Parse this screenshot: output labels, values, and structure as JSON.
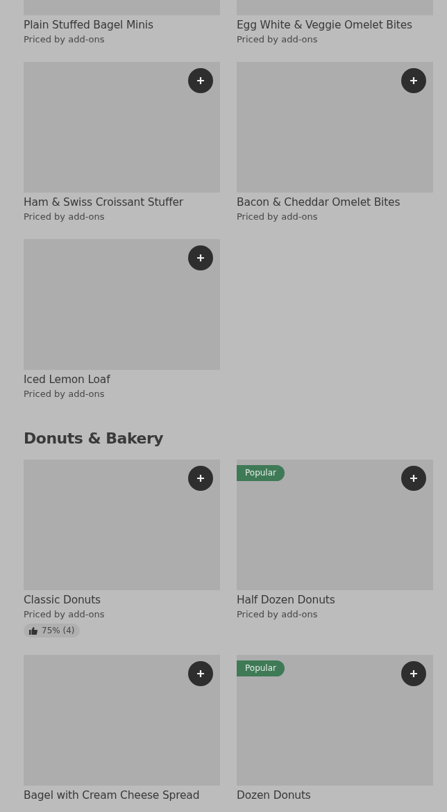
{
  "sections": [
    {
      "top_cut": true,
      "items": [
        {
          "name": "Plain Stuffed Bagel Minis",
          "subtitle": "Priced by add-ons"
        },
        {
          "name": "Egg White & Veggie Omelet Bites",
          "subtitle": "Priced by add-ons"
        },
        {
          "name": "Ham & Swiss Croissant Stuffer",
          "subtitle": "Priced by add-ons"
        },
        {
          "name": "Bacon & Cheddar Omelet Bites",
          "subtitle": "Priced by add-ons"
        },
        {
          "name": "Iced Lemon Loaf",
          "subtitle": "Priced by add-ons"
        }
      ]
    },
    {
      "title": "Donuts & Bakery",
      "items": [
        {
          "name": "Classic Donuts",
          "subtitle": "Priced by add-ons",
          "rating": "75% (4)"
        },
        {
          "name": "Half Dozen Donuts",
          "subtitle": "Priced by add-ons",
          "badge": "Popular"
        },
        {
          "name": "Bagel with Cream Cheese Spread"
        },
        {
          "name": "Dozen Donuts",
          "badge": "Popular"
        }
      ]
    }
  ]
}
